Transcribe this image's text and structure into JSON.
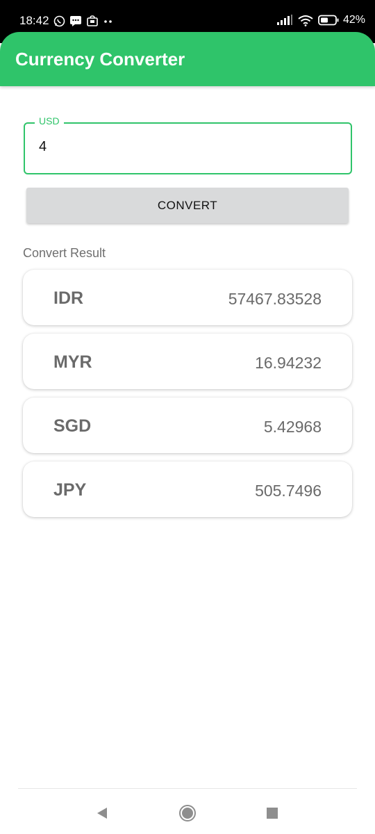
{
  "status_bar": {
    "time": "18:42",
    "battery_percent": "42%",
    "icons": [
      "whatsapp-icon",
      "message-icon",
      "store-icon",
      "dots-icon",
      "signal-icon",
      "wifi-icon",
      "battery-icon"
    ]
  },
  "app": {
    "title": "Currency Converter",
    "accent_color": "#2fc46a"
  },
  "converter": {
    "input_label": "USD",
    "input_value": "4",
    "button_label": "CONVERT"
  },
  "results": {
    "heading": "Convert Result",
    "items": [
      {
        "code": "IDR",
        "value": "57467.83528"
      },
      {
        "code": "MYR",
        "value": "16.94232"
      },
      {
        "code": "SGD",
        "value": "5.42968"
      },
      {
        "code": "JPY",
        "value": "505.7496"
      }
    ]
  },
  "nav_bar": {
    "buttons": [
      "back-icon",
      "home-icon",
      "recents-icon"
    ]
  }
}
